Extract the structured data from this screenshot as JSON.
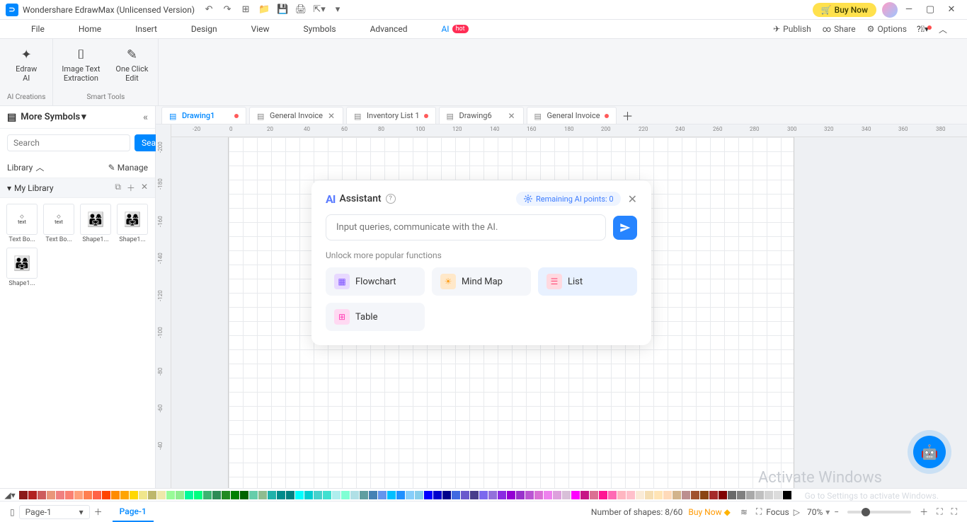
{
  "title": "Wondershare EdrawMax (Unlicensed Version)",
  "buy_now": "Buy Now",
  "menu": {
    "file": "File",
    "home": "Home",
    "insert": "Insert",
    "design": "Design",
    "view": "View",
    "symbols": "Symbols",
    "advanced": "Advanced",
    "ai": "AI",
    "hot": "hot",
    "publish": "Publish",
    "share": "Share",
    "options": "Options"
  },
  "ribbon": {
    "edraw_ai": "Edraw\nAI",
    "image_text": "Image Text\nExtraction",
    "one_click": "One Click\nEdit",
    "group1": "AI Creations",
    "group2": "Smart Tools"
  },
  "sidebar": {
    "more_symbols": "More Symbols",
    "search_ph": "Search",
    "search_btn": "Search",
    "library": "Library",
    "manage": "Manage",
    "my_library": "My Library",
    "shapes": [
      {
        "name": "Text Bo..."
      },
      {
        "name": "Text Bo..."
      },
      {
        "name": "Shape1..."
      },
      {
        "name": "Shape1..."
      },
      {
        "name": "Shape1..."
      }
    ]
  },
  "tabs": [
    {
      "name": "Drawing1",
      "dirty": true,
      "active": true
    },
    {
      "name": "General Invoice",
      "dirty": false,
      "active": false
    },
    {
      "name": "Inventory List 1",
      "dirty": true,
      "active": false
    },
    {
      "name": "Drawing6",
      "dirty": false,
      "active": false
    },
    {
      "name": "General Invoice",
      "dirty": true,
      "active": false
    }
  ],
  "ruler_h": [
    "-20",
    "0",
    "20",
    "40",
    "60",
    "80",
    "100",
    "120",
    "140",
    "160",
    "180",
    "200",
    "220",
    "240",
    "260",
    "280",
    "300",
    "320",
    "340",
    "360",
    "380"
  ],
  "ruler_v": [
    "-200",
    "-180",
    "-160",
    "-140",
    "-120",
    "-100",
    "-80",
    "-60",
    "-40"
  ],
  "ai": {
    "title": "Assistant",
    "points_label": "Remaining AI points: 0",
    "input_ph": "Input queries, communicate with the AI.",
    "subtitle": "Unlock more popular functions",
    "funcs": {
      "flowchart": "Flowchart",
      "mindmap": "Mind Map",
      "list": "List",
      "table": "Table"
    }
  },
  "watermark": "Activate Windows",
  "watermark2": "Go to Settings to activate Windows.",
  "status": {
    "page_sel": "Page-1",
    "page_tab": "Page-1",
    "shapes": "Number of shapes: 8/60",
    "buy_now": "Buy Now",
    "focus": "Focus",
    "zoom": "70%"
  },
  "colors": [
    "#8b1a1a",
    "#b22222",
    "#cd5c5c",
    "#e9967a",
    "#f08080",
    "#fa8072",
    "#ffa07a",
    "#ff7f50",
    "#ff6347",
    "#ff4500",
    "#ff8c00",
    "#ffa500",
    "#ffd700",
    "#f0e68c",
    "#bdb76b",
    "#eee8aa",
    "#98fb98",
    "#90ee90",
    "#00fa9a",
    "#00ff7f",
    "#3cb371",
    "#2e8b57",
    "#228b22",
    "#008000",
    "#006400",
    "#66cdaa",
    "#8fbc8f",
    "#20b2aa",
    "#008b8b",
    "#008080",
    "#00ffff",
    "#00ced1",
    "#48d1cc",
    "#40e0d0",
    "#afeeee",
    "#7fffd4",
    "#b0e0e6",
    "#5f9ea0",
    "#4682b4",
    "#6495ed",
    "#00bfff",
    "#1e90ff",
    "#87cefa",
    "#87ceeb",
    "#0000ff",
    "#0000cd",
    "#00008b",
    "#4169e1",
    "#6a5acd",
    "#483d8b",
    "#7b68ee",
    "#9370db",
    "#8a2be2",
    "#9400d3",
    "#9932cc",
    "#ba55d3",
    "#da70d6",
    "#ee82ee",
    "#dda0dd",
    "#d8bfd8",
    "#ff00ff",
    "#c71585",
    "#db7093",
    "#ff1493",
    "#ff69b4",
    "#ffb6c1",
    "#ffc0cb",
    "#faebd7",
    "#f5deb3",
    "#ffe4b5",
    "#ffdab9",
    "#d2b48c",
    "#bc8f8f",
    "#a0522d",
    "#8b4513",
    "#a52a2a",
    "#800000",
    "#696969",
    "#808080",
    "#a9a9a9",
    "#c0c0c0",
    "#d3d3d3",
    "#dcdcdc",
    "#000000"
  ]
}
